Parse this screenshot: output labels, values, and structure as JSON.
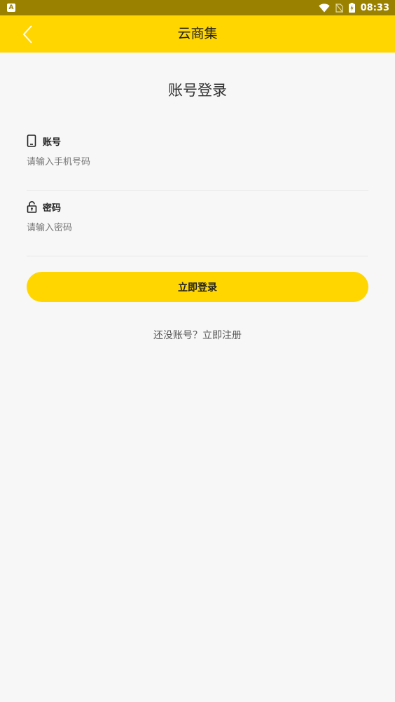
{
  "status_bar": {
    "app_icon_letter": "A",
    "time": "08:33",
    "icons": [
      "wifi-icon",
      "no-sim-icon",
      "battery-charging-icon"
    ]
  },
  "app_bar": {
    "title": "云商集",
    "back_icon": "chevron-left-icon"
  },
  "login": {
    "heading": "账号登录",
    "account": {
      "icon": "phone-icon",
      "label": "账号",
      "placeholder": "请输入手机号码",
      "value": ""
    },
    "password": {
      "icon": "lock-icon",
      "label": "密码",
      "placeholder": "请输入密码",
      "value": ""
    },
    "submit_label": "立即登录",
    "register_prompt": "还没账号？",
    "register_link": "立即注册"
  },
  "colors": {
    "accent": "#ffd600",
    "status_bar": "#9a8100",
    "background": "#f7f7f7"
  }
}
